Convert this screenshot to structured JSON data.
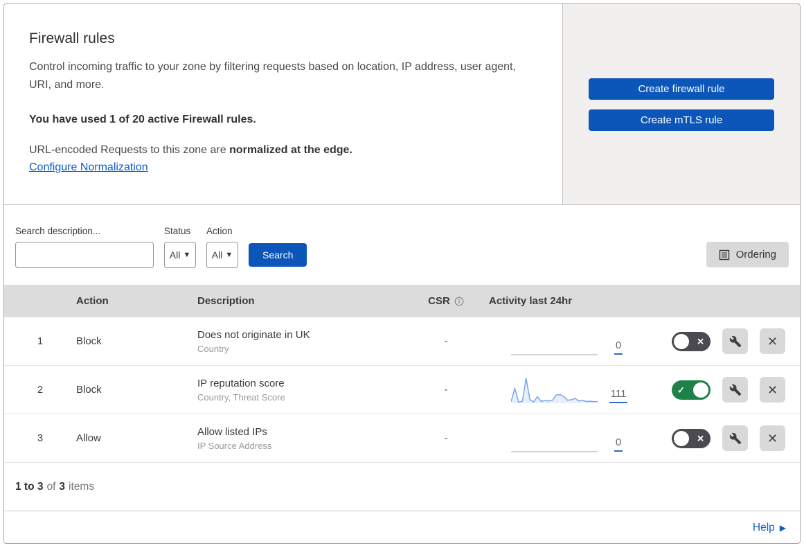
{
  "header": {
    "title": "Firewall rules",
    "description": "Control incoming traffic to your zone by filtering requests based on location, IP address, user agent, URI, and more.",
    "usage": "You have used 1 of 20 active Firewall rules.",
    "normalization_text": "URL-encoded Requests to this zone are ",
    "normalization_bold": "normalized at the edge.",
    "normalization_link": "Configure Normalization"
  },
  "actions_panel": {
    "create_firewall_rule": "Create firewall rule",
    "create_mtls_rule": "Create mTLS rule"
  },
  "filters": {
    "search_label": "Search description...",
    "search_value": "",
    "status_label": "Status",
    "status_value": "All",
    "action_label": "Action",
    "action_value": "All",
    "search_button": "Search",
    "ordering_button": "Ordering"
  },
  "table": {
    "columns": {
      "action": "Action",
      "description": "Description",
      "csr": "CSR",
      "activity": "Activity last 24hr"
    },
    "rows": [
      {
        "index": "1",
        "action": "Block",
        "description": "Does not originate in UK",
        "fields": "Country",
        "csr": "-",
        "activity_count": "0",
        "enabled": false,
        "sparkline": [
          0,
          0,
          0,
          0,
          0,
          0,
          0,
          0,
          0,
          0,
          0,
          0,
          0,
          0,
          0,
          0,
          0,
          0,
          0,
          0,
          0,
          0,
          0,
          0
        ]
      },
      {
        "index": "2",
        "action": "Block",
        "description": "IP reputation score",
        "fields": "Country, Threat Score",
        "csr": "-",
        "activity_count": "111",
        "enabled": true,
        "sparkline": [
          6,
          60,
          4,
          8,
          100,
          14,
          5,
          26,
          7,
          11,
          9,
          12,
          33,
          35,
          27,
          12,
          14,
          19,
          9,
          11,
          7,
          8,
          6,
          7
        ]
      },
      {
        "index": "3",
        "action": "Allow",
        "description": "Allow listed IPs",
        "fields": "IP Source Address",
        "csr": "-",
        "activity_count": "0",
        "enabled": false,
        "sparkline": [
          0,
          0,
          0,
          0,
          0,
          0,
          0,
          0,
          0,
          0,
          0,
          0,
          0,
          0,
          0,
          0,
          0,
          0,
          0,
          0,
          0,
          0,
          0,
          0
        ]
      }
    ]
  },
  "footer": {
    "range_bold": "1 to 3",
    "of_text": "of",
    "total_bold": "3",
    "items_text": "items",
    "help_label": "Help"
  },
  "colors": {
    "accent_blue": "#0b56b8",
    "link_blue": "#0d5dc5",
    "toggle_on_green": "#1e8148",
    "toggle_off_gray": "#4a4a50",
    "sparkline_blue": "#7aa6e8",
    "sparkline_fill": "rgba(122,166,232,0.18)",
    "flat_line_gray": "#b9b9b9"
  }
}
